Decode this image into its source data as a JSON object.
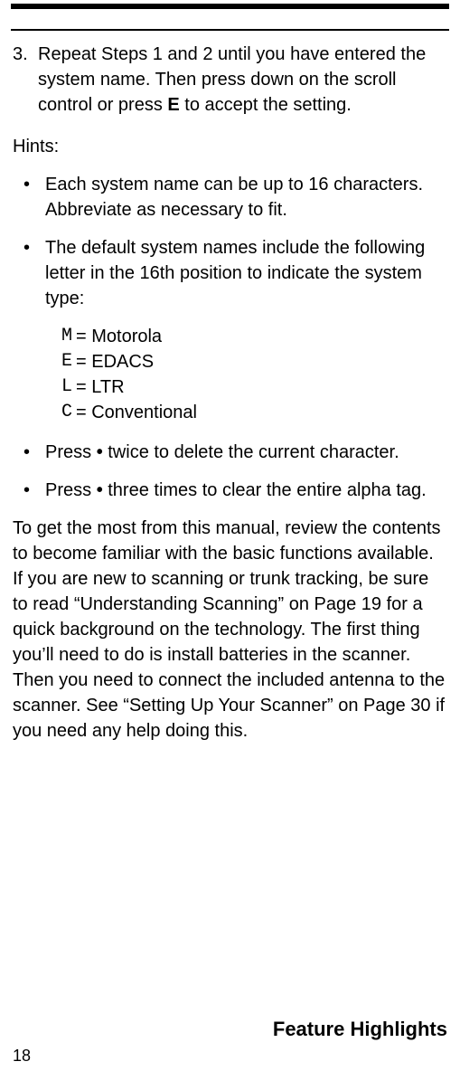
{
  "step3": {
    "number": "3.",
    "text_before_key": "Repeat Steps 1 and 2 until you have entered the system name. Then press down on the scroll control or press ",
    "key": "E",
    "text_after_key": " to accept the setting."
  },
  "hints_label": "Hints:",
  "hint1": "Each system name can be up to 16 characters. Abbreviate as necessary to fit.",
  "hint2": "The default system names include the following letter in the 16th position to indicate the system type:",
  "system_types": [
    {
      "code": "M",
      "label": " = Motorola"
    },
    {
      "code": "E",
      "label": " = EDACS"
    },
    {
      "code": "L",
      "label": " = LTR"
    },
    {
      "code": "C",
      "label": " = Conventional"
    }
  ],
  "hint3_before": "Press ",
  "hint3_glyph": " • ",
  "hint3_after": " twice to delete the current character.",
  "hint4_before": "Press ",
  "hint4_glyph": " • ",
  "hint4_after": " three times to clear the entire alpha tag.",
  "paragraph": "To get the most from this manual, review the contents to become familiar with the basic functions available. If you are new to scanning or trunk tracking, be sure to read “Understanding Scanning” on Page 19 for a quick background on the technology. The first thing you’ll need to do is install batteries in the scanner. Then you need to connect the included antenna to the scanner. See “Setting Up Your Scanner” on Page 30 if you need any help doing this.",
  "footer": "Feature Highlights",
  "page_number": "18",
  "bullet": "•"
}
